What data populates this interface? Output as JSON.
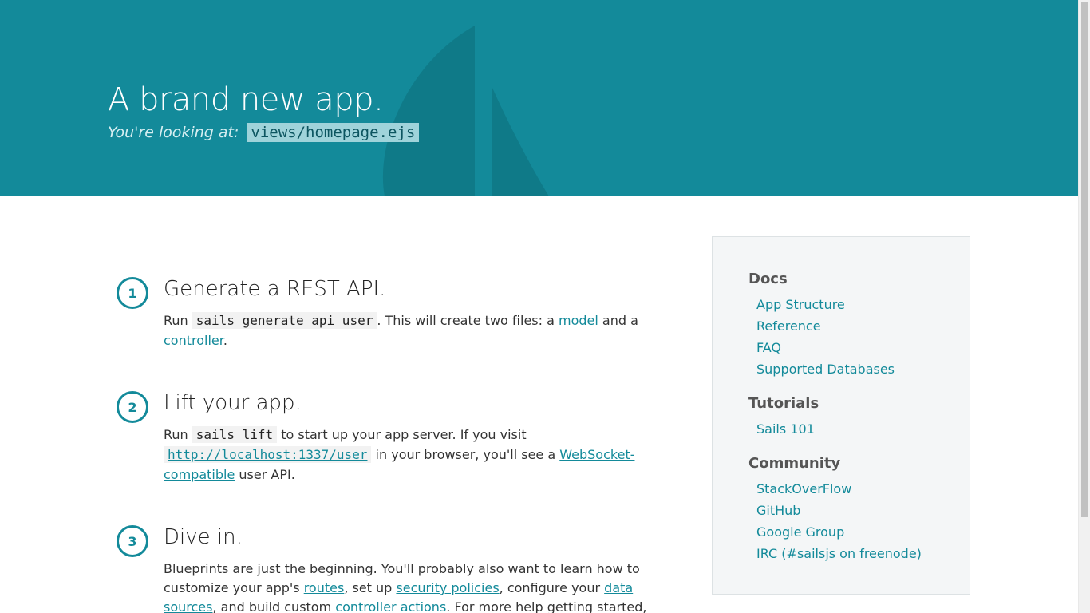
{
  "hero": {
    "title": "A brand new app.",
    "subtitle_prefix": "You're looking at:",
    "file_path": "views/homepage.ejs"
  },
  "steps": [
    {
      "number": "1",
      "title": "Generate a REST API.",
      "text": {
        "run": "Run",
        "command": "sails generate api user",
        "middle": ". This will create two files: a",
        "link1": "model",
        "and": "and a",
        "link2": "controller",
        "end": "."
      }
    },
    {
      "number": "2",
      "title": "Lift your app.",
      "text": {
        "run": "Run",
        "command": "sails lift",
        "middle": "to start up your app server. If you visit",
        "url": "http://localhost:1337/user",
        "middle2": "in your browser, you'll see a",
        "link": "WebSocket-compatible",
        "end": "user API."
      }
    },
    {
      "number": "3",
      "title": "Dive in.",
      "text": {
        "intro": "Blueprints are just the beginning. You'll probably also want to learn how to customize your app's",
        "link_routes": "routes",
        "set_up": ", set up",
        "link_security": "security policies",
        "configure": ", configure your",
        "link_data": "data sources",
        "and_build": ", and build custom",
        "link_actions": "controller actions",
        "end": ". For more help getting started, check out the links on this"
      }
    }
  ],
  "sidebar": {
    "sections": [
      {
        "heading": "Docs",
        "links": [
          "App Structure",
          "Reference",
          "FAQ",
          "Supported Databases"
        ]
      },
      {
        "heading": "Tutorials",
        "links": [
          "Sails 101"
        ]
      },
      {
        "heading": "Community",
        "links": [
          "StackOverFlow",
          "GitHub",
          "Google Group",
          "IRC (#sailsjs on freenode)"
        ]
      }
    ]
  },
  "colors": {
    "accent": "#138a9a",
    "hero_bg": "#138a9a"
  }
}
